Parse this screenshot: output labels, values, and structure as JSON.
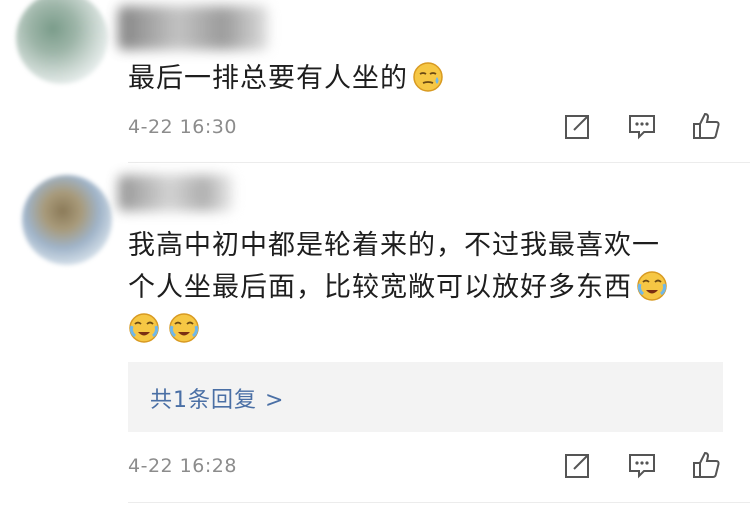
{
  "comments": [
    {
      "text": "最后一排总要有人坐的",
      "emoji": "smirk-sweat-icon",
      "time": "4-22 16:30"
    },
    {
      "text_line1": "我高中初中都是轮着来的，不过我最喜欢一",
      "text_line2": "个人坐最后面，比较宽敞可以放好多东西",
      "emoji": "loudly-crying-icon",
      "time": "4-22 16:28",
      "reply_label": "共1条回复 >"
    }
  ],
  "colors": {
    "link": "#4a6fa5",
    "time": "#8c8c8c",
    "divider": "#ececec"
  }
}
